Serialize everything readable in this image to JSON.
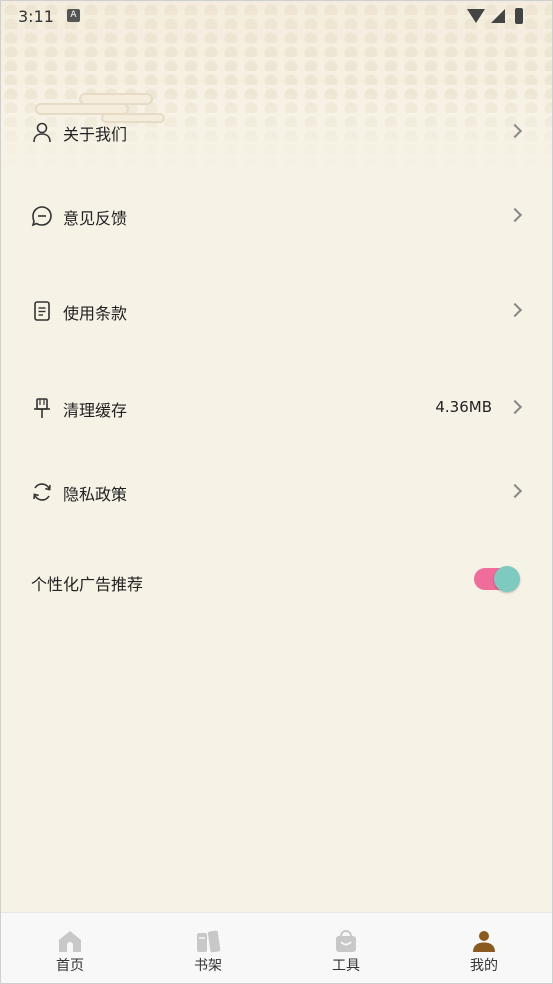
{
  "status_bar": {
    "time": "3:11",
    "notification_badge": "A"
  },
  "menu": {
    "items": [
      {
        "label": "关于我们",
        "icon": "person-icon",
        "value": ""
      },
      {
        "label": "意见反馈",
        "icon": "chat-icon",
        "value": ""
      },
      {
        "label": "使用条款",
        "icon": "document-icon",
        "value": ""
      },
      {
        "label": "清理缓存",
        "icon": "brush-icon",
        "value": "4.36MB"
      },
      {
        "label": "隐私政策",
        "icon": "refresh-icon",
        "value": ""
      }
    ],
    "toggle": {
      "label": "个性化广告推荐",
      "enabled": true
    }
  },
  "bottom_nav": {
    "items": [
      {
        "label": "首页",
        "icon": "home-icon",
        "active": false
      },
      {
        "label": "书架",
        "icon": "bookshelf-icon",
        "active": false
      },
      {
        "label": "工具",
        "icon": "toolbag-icon",
        "active": false
      },
      {
        "label": "我的",
        "icon": "profile-icon",
        "active": true
      }
    ]
  },
  "colors": {
    "background": "#f7f2e6",
    "toggle_track": "#f06c9b",
    "toggle_knob": "#7ecac0",
    "active_nav": "#8a5a1e",
    "inactive_nav": "#c8c8c8"
  }
}
